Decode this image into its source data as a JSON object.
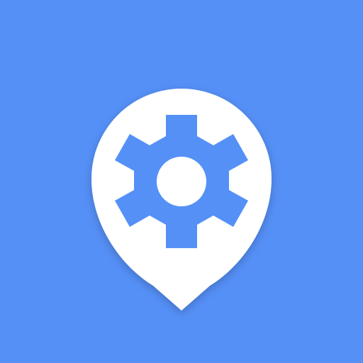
{
  "app_icon": {
    "icon_name": "map-pin-settings-icon",
    "background_color": "#5590F7",
    "pin_color": "#FFFFFF",
    "gear_color": "#5590F7",
    "hole_color": "#FFFFFF"
  }
}
